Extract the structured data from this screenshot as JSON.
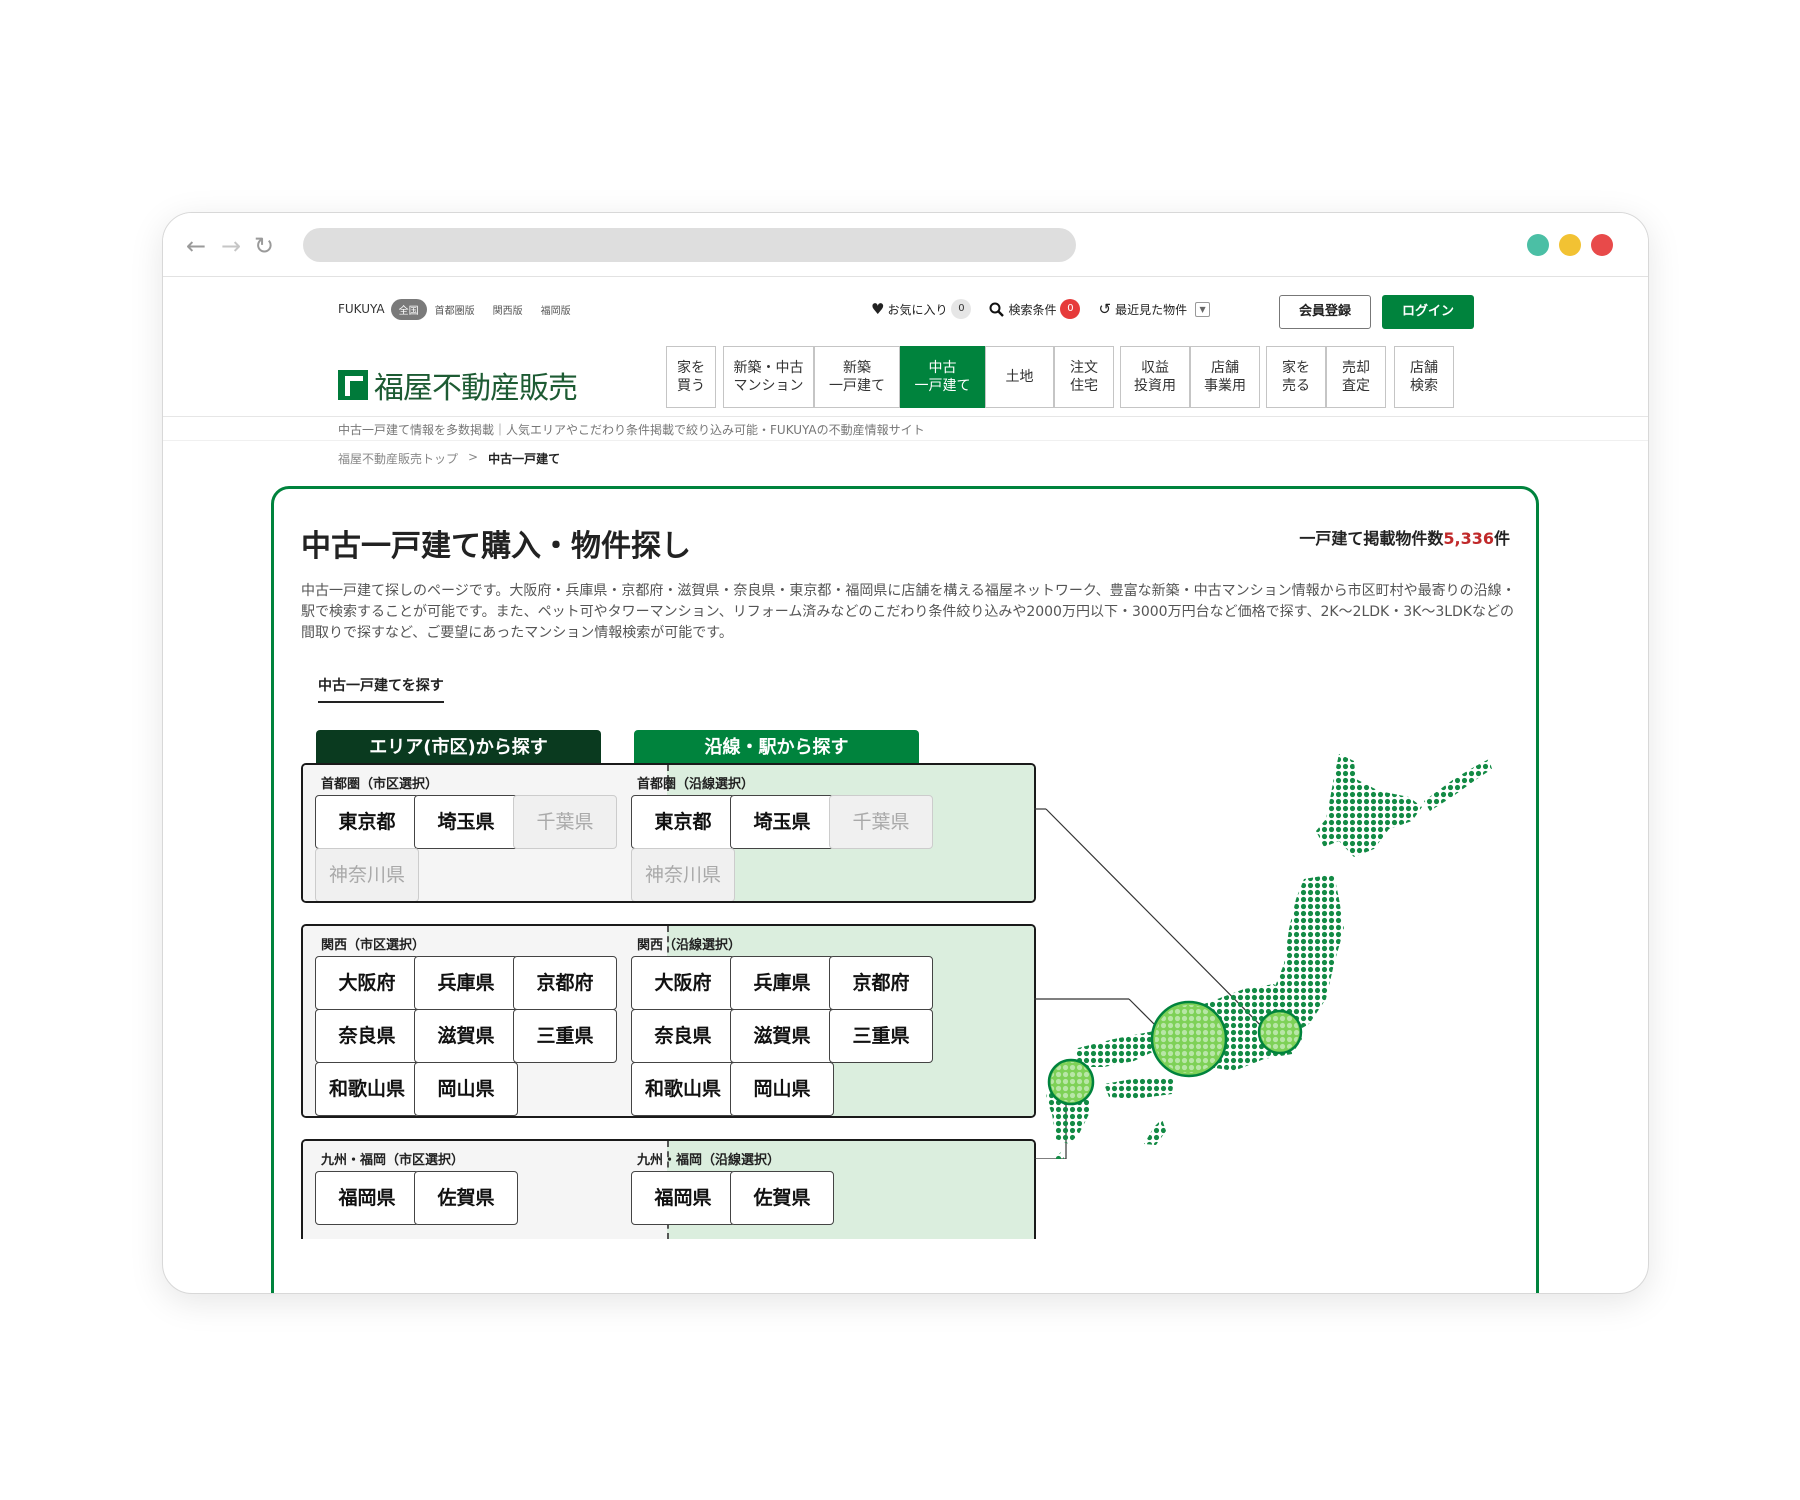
{
  "colors": {
    "accent": "#00833d",
    "dark_tab": "#0a3a1f",
    "red": "#c0292a"
  },
  "browser": {
    "back_icon": "back-arrow-icon",
    "forward_icon": "forward-arrow-icon",
    "reload_icon": "reload-icon"
  },
  "util": {
    "brand": "FUKUYA",
    "editions": [
      "全国",
      "首都圏版",
      "関西版",
      "福岡版"
    ],
    "favorites": "お気に入り",
    "favorites_count": "0",
    "search_conditions": "検索条件",
    "search_conditions_count": "0",
    "recent": "最近見た物件",
    "register": "会員登録",
    "login": "ログイン"
  },
  "logo": {
    "text": "福屋不動産販売"
  },
  "nav": [
    {
      "label": "家を\n買う",
      "active": false
    },
    {
      "label": "新築・中古\nマンション",
      "active": false
    },
    {
      "label": "新築\n一戸建て",
      "active": false
    },
    {
      "label": "中古\n一戸建て",
      "active": true
    },
    {
      "label": "土地",
      "active": false
    },
    {
      "label": "注文\n住宅",
      "active": false
    },
    {
      "label": "収益\n投資用",
      "active": false
    },
    {
      "label": "店舗\n事業用",
      "active": false
    },
    {
      "label": "家を\n売る",
      "active": false
    },
    {
      "label": "売却\n査定",
      "active": false
    },
    {
      "label": "店舗\n検索",
      "active": false
    }
  ],
  "tagline": "中古一戸建て情報を多数掲載｜人気エリアやこだわり条件掲載で絞り込み可能・FUKUYAの不動産情報サイト",
  "breadcrumb": {
    "home": "福屋不動産販売トップ",
    "sep": ">",
    "current": "中古一戸建て"
  },
  "main": {
    "title": "中古一戸建て購入・物件探し",
    "count_prefix": "一戸建て掲載物件数",
    "count_value": "5,336",
    "count_suffix": "件",
    "description": "中古一戸建て探しのページです。大阪府・兵庫県・京都府・滋賀県・奈良県・東京都・福岡県に店舗を構える福屋ネットワーク、豊富な新築・中古マンション情報から市区町村や最寄りの沿線・駅で検索することが可能です。また、ペット可やタワーマンション、リフォーム済みなどのこだわり条件絞り込みや2000万円以下・3000万円台など価格で探す、2K〜2LDK・3K〜3LDKなどの間取りで探すなど、ご要望にあったマンション情報検索が可能です。",
    "section_title": "中古一戸建てを探す",
    "tab_area": "エリア(市区)から探す",
    "tab_line": "沿線・駅から探す"
  },
  "panels": [
    {
      "area_label": "首都圏（市区選択）",
      "line_label": "首都圏（沿線選択）",
      "buttons": [
        {
          "label": "東京都",
          "enabled": true
        },
        {
          "label": "埼玉県",
          "enabled": true
        },
        {
          "label": "千葉県",
          "enabled": false
        },
        {
          "label": "神奈川県",
          "enabled": false
        }
      ]
    },
    {
      "area_label": "関西（市区選択）",
      "line_label": "関西（沿線選択）",
      "buttons": [
        {
          "label": "大阪府",
          "enabled": true
        },
        {
          "label": "兵庫県",
          "enabled": true
        },
        {
          "label": "京都府",
          "enabled": true
        },
        {
          "label": "奈良県",
          "enabled": true
        },
        {
          "label": "滋賀県",
          "enabled": true
        },
        {
          "label": "三重県",
          "enabled": true
        },
        {
          "label": "和歌山県",
          "enabled": true
        },
        {
          "label": "岡山県",
          "enabled": true
        }
      ]
    },
    {
      "area_label": "九州・福岡（市区選択）",
      "line_label": "九州・福岡（沿線選択）",
      "buttons": [
        {
          "label": "福岡県",
          "enabled": true
        },
        {
          "label": "佐賀県",
          "enabled": true
        }
      ]
    }
  ]
}
